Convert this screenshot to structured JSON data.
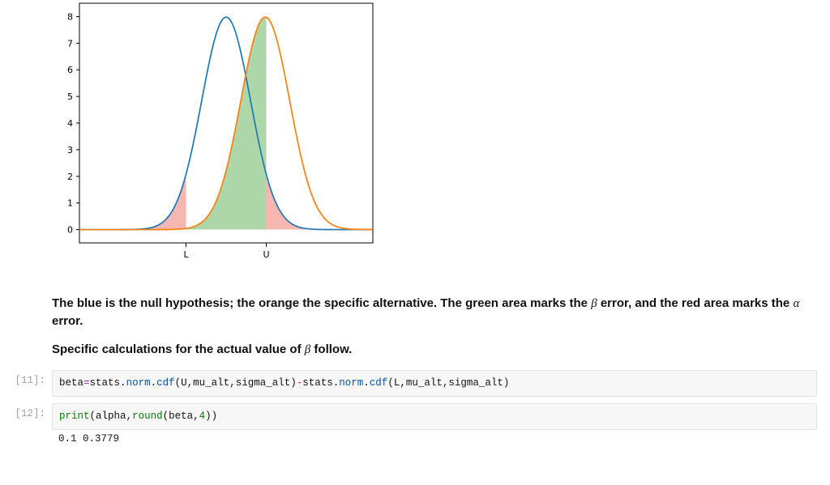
{
  "chart_data": {
    "type": "line",
    "title": "",
    "xlabel": "",
    "ylabel": "",
    "x_ticklabels": [
      "L",
      "U"
    ],
    "y_ticks": [
      0,
      1,
      2,
      3,
      4,
      5,
      6,
      7,
      8
    ],
    "ylim": [
      -0.5,
      8.5
    ],
    "xlim_implied": [
      -0.3,
      0.3
    ],
    "L": -0.082,
    "U": 0.082,
    "series": [
      {
        "name": "null hypothesis",
        "color": "#1f77b4",
        "dist": "normal",
        "mu": 0.0,
        "sigma": 0.05
      },
      {
        "name": "specific alternative",
        "color": "#ff7f0e",
        "dist": "normal",
        "mu": 0.08,
        "sigma": 0.05
      }
    ],
    "shaded_regions": [
      {
        "name": "alpha lower tail",
        "color": "#f4a9a3",
        "under_series": 0,
        "from": "xmin",
        "to": "L"
      },
      {
        "name": "alpha upper tail",
        "color": "#f4a9a3",
        "under_series": 0,
        "from": "U",
        "to": "xmax"
      },
      {
        "name": "beta region",
        "color": "#9fcf9a",
        "under_series": 1,
        "from": "L",
        "to": "U"
      }
    ],
    "legend": null
  },
  "explanation": {
    "line1_a": "The blue is the null hypothesis; the orange the specific alternative. The green area marks the ",
    "beta_sym": "β",
    "line1_b": " error, and the red area marks the ",
    "alpha_sym": "α",
    "line1_c": " error.",
    "line2_a": "Specific calculations for the actual value of ",
    "line2_b": " follow."
  },
  "cells": {
    "c11": {
      "prompt": "[11]:",
      "code_plain": "beta=stats.norm.cdf(U,mu_alt,sigma_alt)-stats.norm.cdf(L,mu_alt,sigma_alt)",
      "tokens": [
        {
          "t": "beta",
          "c": "tok-name"
        },
        {
          "t": "=",
          "c": "tok-op"
        },
        {
          "t": "stats",
          "c": "tok-name"
        },
        {
          "t": ".",
          "c": "tok-punct"
        },
        {
          "t": "norm",
          "c": "tok-blue"
        },
        {
          "t": ".",
          "c": "tok-punct"
        },
        {
          "t": "cdf",
          "c": "tok-blue"
        },
        {
          "t": "(",
          "c": "tok-punct"
        },
        {
          "t": "U",
          "c": "tok-name"
        },
        {
          "t": ",",
          "c": "tok-punct"
        },
        {
          "t": "mu_alt",
          "c": "tok-name"
        },
        {
          "t": ",",
          "c": "tok-punct"
        },
        {
          "t": "sigma_alt",
          "c": "tok-name"
        },
        {
          "t": ")",
          "c": "tok-punct"
        },
        {
          "t": "-",
          "c": "tok-op"
        },
        {
          "t": "stats",
          "c": "tok-name"
        },
        {
          "t": ".",
          "c": "tok-punct"
        },
        {
          "t": "norm",
          "c": "tok-blue"
        },
        {
          "t": ".",
          "c": "tok-punct"
        },
        {
          "t": "cdf",
          "c": "tok-blue"
        },
        {
          "t": "(",
          "c": "tok-punct"
        },
        {
          "t": "L",
          "c": "tok-name"
        },
        {
          "t": ",",
          "c": "tok-punct"
        },
        {
          "t": "mu_alt",
          "c": "tok-name"
        },
        {
          "t": ",",
          "c": "tok-punct"
        },
        {
          "t": "sigma_alt",
          "c": "tok-name"
        },
        {
          "t": ")",
          "c": "tok-punct"
        }
      ]
    },
    "c12": {
      "prompt": "[12]:",
      "code_plain": "print(alpha,round(beta,4))",
      "tokens": [
        {
          "t": "print",
          "c": "tok-func"
        },
        {
          "t": "(",
          "c": "tok-punct"
        },
        {
          "t": "alpha",
          "c": "tok-name"
        },
        {
          "t": ",",
          "c": "tok-punct"
        },
        {
          "t": "round",
          "c": "tok-func"
        },
        {
          "t": "(",
          "c": "tok-punct"
        },
        {
          "t": "beta",
          "c": "tok-name"
        },
        {
          "t": ",",
          "c": "tok-punct"
        },
        {
          "t": "4",
          "c": "tok-num"
        },
        {
          "t": ")",
          "c": "tok-punct"
        },
        {
          "t": ")",
          "c": "tok-punct"
        }
      ],
      "output": "0.1 0.3779"
    }
  }
}
